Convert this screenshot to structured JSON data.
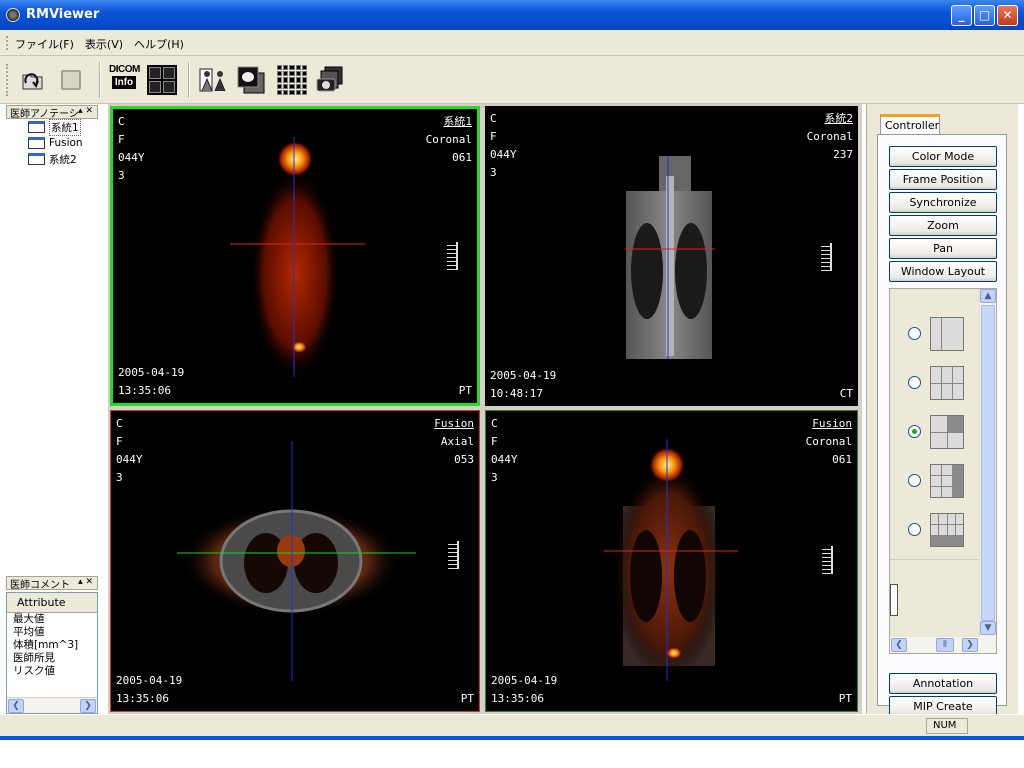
{
  "window": {
    "title": "RMViewer",
    "minimize": "_",
    "maximize": "□",
    "close": "✕"
  },
  "menu": [
    "ファイル(F)",
    "表示(V)",
    "ヘルプ(H)"
  ],
  "toolbar": {
    "dicom_top": "DICOM",
    "dicom_bottom": "Info"
  },
  "annotation_panel": {
    "title": "医師アノテーシ",
    "items": [
      "系統1",
      "Fusion",
      "系統2"
    ],
    "selected": 0
  },
  "comment_panel": {
    "title": "医師コメント",
    "column": "Attribute",
    "rows": [
      "最大値",
      "平均値",
      "体積[mm^3]",
      "医師所見",
      "リスク値"
    ]
  },
  "viewports": [
    {
      "series": "系統1",
      "l1": "C",
      "l2": "F",
      "l3": "044Y",
      "l4": "3",
      "orientation": "Coronal",
      "slice": "061",
      "date": "2005-04-19",
      "time": "13:35:06",
      "modality": "PT",
      "border": "#22dd22"
    },
    {
      "series": "系統2",
      "l1": "C",
      "l2": "F",
      "l3": "044Y",
      "l4": "3",
      "orientation": "Coronal",
      "slice": "237",
      "date": "2005-04-19",
      "time": "10:48:17",
      "modality": "CT",
      "border": "#000000"
    },
    {
      "series": "Fusion",
      "l1": "C",
      "l2": "F",
      "l3": "044Y",
      "l4": "3",
      "orientation": "Axial",
      "slice": "053",
      "date": "2005-04-19",
      "time": "13:35:06",
      "modality": "PT",
      "border": "#d33333"
    },
    {
      "series": "Fusion",
      "l1": "C",
      "l2": "F",
      "l3": "044Y",
      "l4": "3",
      "orientation": "Coronal",
      "slice": "061",
      "date": "2005-04-19",
      "time": "13:35:06",
      "modality": "PT",
      "border": "#228822"
    }
  ],
  "controller": {
    "tab": "Controller",
    "buttons": [
      "Color Mode",
      "Frame Position",
      "Synchronize",
      "Zoom",
      "Pan",
      "Window Layout"
    ],
    "bottom_buttons": [
      "Annotation",
      "MIP Create"
    ],
    "layout_selected": 2
  },
  "status": {
    "num": "NUM"
  }
}
